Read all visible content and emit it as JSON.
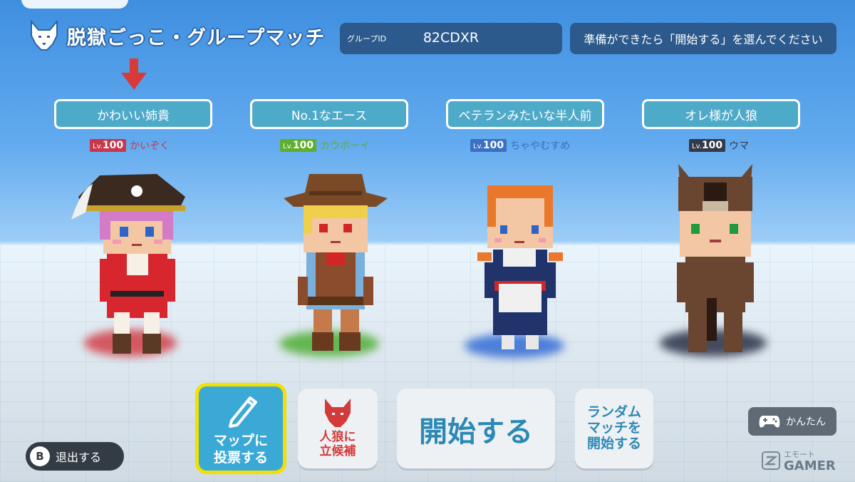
{
  "header": {
    "title": "脱獄ごっこ・グループマッチ",
    "group_id_label": "グループID",
    "group_id_value": "82CDXR",
    "notice": "準備ができたら「開始する」を選んでください"
  },
  "players": [
    {
      "name": "かわいい姉貴",
      "level_prefix": "Lv.",
      "level": "100",
      "costume": "かいぞく",
      "color": "#c8374a"
    },
    {
      "name": "No.1なエース",
      "level_prefix": "Lv.",
      "level": "100",
      "costume": "カウボーイ",
      "color": "#5fae2d"
    },
    {
      "name": "ベテランみたいな半人前",
      "level_prefix": "Lv.",
      "level": "100",
      "costume": "ちゃやむすめ",
      "color": "#3a6fc2"
    },
    {
      "name": "オレ様が人狼",
      "level_prefix": "Lv.",
      "level": "100",
      "costume": "ウマ",
      "color": "#333a4a"
    }
  ],
  "buttons": {
    "vote_map": "マップに\n投票する",
    "werewolf_candidate": "人狼に\n立候補",
    "start": "開始する",
    "random_match": "ランダム\nマッチを\n開始する",
    "exit_key": "B",
    "exit": "退出する",
    "easy": "かんたん"
  },
  "brand": {
    "top": "エモート",
    "name": "GAMER"
  }
}
